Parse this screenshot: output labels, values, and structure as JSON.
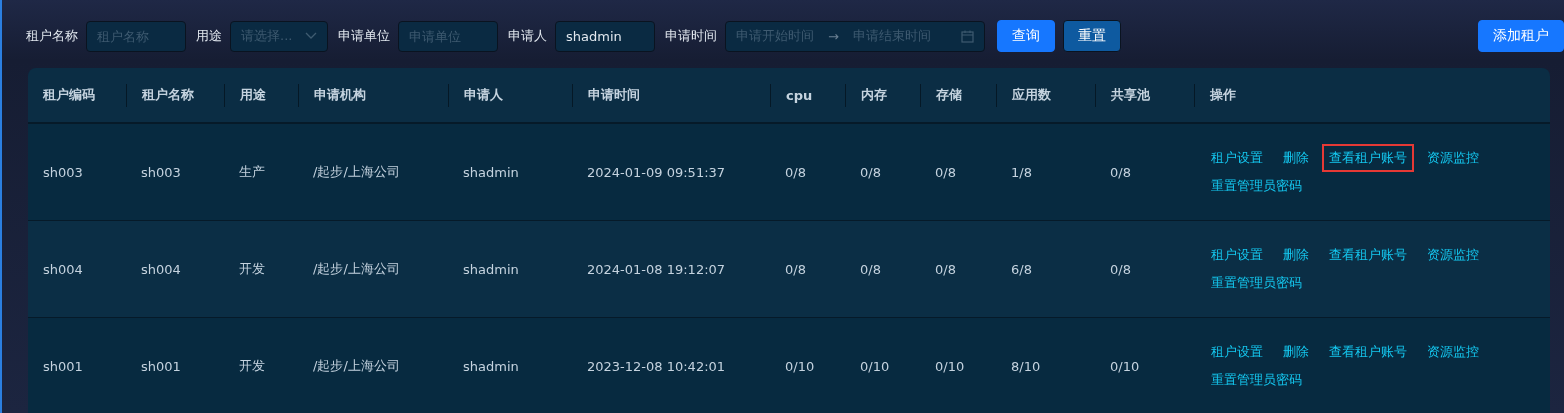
{
  "filters": [
    {
      "label": "租户名称",
      "kind": "text",
      "placeholder": "租户名称"
    },
    {
      "label": "用途",
      "kind": "select",
      "placeholder": "请选择..."
    },
    {
      "label": "申请单位",
      "kind": "text",
      "placeholder": "申请单位"
    },
    {
      "label": "申请人",
      "kind": "text",
      "value": "shadmin"
    },
    {
      "label": "申请时间",
      "kind": "range",
      "placeholder": "申请开始时间",
      "placeholder_end": "申请结束时间",
      "separator": "→"
    }
  ],
  "buttons": [
    {
      "label": "查询",
      "kind": "primary"
    },
    {
      "label": "重置",
      "kind": "secondary"
    }
  ],
  "add_button": "添加租户",
  "table": {
    "columns": [
      "租户编码",
      "租户名称",
      "用途",
      "申请机构",
      "申请人",
      "申请时间",
      "cpu",
      "内存",
      "存储",
      "应用数",
      "共享池",
      "操作"
    ],
    "rows": [
      {
        "cells": [
          "sh003",
          "sh003",
          "生产",
          "/起步/上海公司",
          "shadmin",
          "2024-01-09 09:51:37",
          "0/8",
          "0/8",
          "0/8",
          "1/8",
          "0/8"
        ],
        "actions": [
          {
            "label": "租户设置",
            "highlighted": false
          },
          {
            "label": "删除",
            "highlighted": false
          },
          {
            "label": "查看租户账号",
            "highlighted": true
          },
          {
            "label": "资源监控",
            "highlighted": false
          },
          {
            "label": "重置管理员密码",
            "highlighted": false
          }
        ]
      },
      {
        "cells": [
          "sh004",
          "sh004",
          "开发",
          "/起步/上海公司",
          "shadmin",
          "2024-01-08 19:12:07",
          "0/8",
          "0/8",
          "0/8",
          "6/8",
          "0/8"
        ],
        "actions": [
          {
            "label": "租户设置",
            "highlighted": false
          },
          {
            "label": "删除",
            "highlighted": false
          },
          {
            "label": "查看租户账号",
            "highlighted": false
          },
          {
            "label": "资源监控",
            "highlighted": false
          },
          {
            "label": "重置管理员密码",
            "highlighted": false
          }
        ]
      },
      {
        "cells": [
          "sh001",
          "sh001",
          "开发",
          "/起步/上海公司",
          "shadmin",
          "2023-12-08 10:42:01",
          "0/10",
          "0/10",
          "0/10",
          "8/10",
          "0/10"
        ],
        "actions": [
          {
            "label": "租户设置",
            "highlighted": false
          },
          {
            "label": "删除",
            "highlighted": false
          },
          {
            "label": "查看租户账号",
            "highlighted": false
          },
          {
            "label": "资源监控",
            "highlighted": false
          },
          {
            "label": "重置管理员密码",
            "highlighted": false
          }
        ]
      }
    ]
  }
}
